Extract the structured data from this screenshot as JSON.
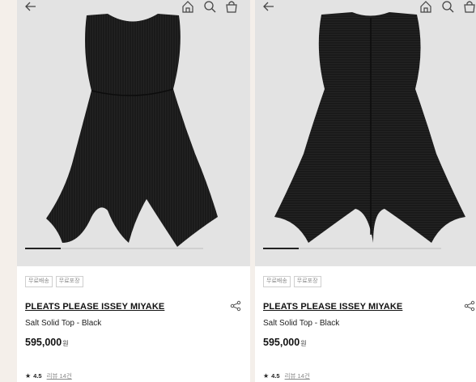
{
  "products": [
    {
      "tags": [
        "무료배송",
        "무료포장"
      ],
      "brand": "PLEATS PLEASE ISSEY MIYAKE",
      "name": "Salt Solid Top - Black",
      "price": "595,000",
      "currency": "원",
      "rating": "4.5",
      "reviews_label": "리뷰 14건",
      "image_view": "front",
      "slider_progress": 0.2
    },
    {
      "tags": [
        "무료배송",
        "무료포장"
      ],
      "brand": "PLEATS PLEASE ISSEY MIYAKE",
      "name": "Salt Solid Top - Black",
      "price": "595,000",
      "currency": "원",
      "rating": "4.5",
      "reviews_label": "리뷰 14건",
      "image_view": "back",
      "slider_progress": 0.2
    }
  ],
  "icons": {
    "back": "arrow-left-icon",
    "home": "home-icon",
    "search": "search-icon",
    "bag": "shopping-bag-icon",
    "share": "share-icon",
    "star": "star-icon"
  },
  "colors": {
    "photo_bg": "#e3e3e3",
    "garment": "#1a1a1a",
    "page_bg": "#f4efea"
  }
}
